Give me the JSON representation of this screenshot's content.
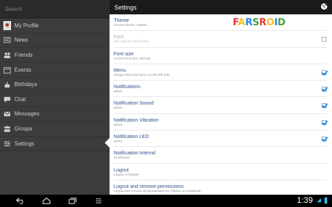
{
  "drawer": {
    "search_placeholder": "Search",
    "items": [
      {
        "label": "My Profile",
        "icon": "avatar"
      },
      {
        "label": "News",
        "icon": "news-icon"
      },
      {
        "label": "Friends",
        "icon": "friends-icon"
      },
      {
        "label": "Events",
        "icon": "calendar-icon"
      },
      {
        "label": "Birthdays",
        "icon": "birthday-icon"
      },
      {
        "label": "Chat",
        "icon": "chat-icon"
      },
      {
        "label": "Messages",
        "icon": "mail-icon"
      },
      {
        "label": "Groups",
        "icon": "groups-icon"
      },
      {
        "label": "Settings",
        "icon": "settings-icon"
      }
    ]
  },
  "header": {
    "title": "Settings"
  },
  "logo": {
    "text": "FARSROID",
    "colors": [
      "#e53935",
      "#fbc02d",
      "#1e88e5",
      "#43a047"
    ]
  },
  "settings": [
    {
      "title": "Theme",
      "subtitle": "Current theme: Classic",
      "checkbox": null,
      "enabled": true
    },
    {
      "title": "Font",
      "subtitle": "Use default Android font",
      "checkbox": false,
      "enabled": false
    },
    {
      "title": "Font size",
      "subtitle": "Current font size: Normal",
      "checkbox": null,
      "enabled": true
    },
    {
      "title": "Menu",
      "subtitle": "Always show the menu on the left side.",
      "checkbox": true,
      "enabled": true
    },
    {
      "title": "Notifications",
      "subtitle": "active",
      "checkbox": true,
      "enabled": true
    },
    {
      "title": "Notification Sound",
      "subtitle": "active",
      "checkbox": true,
      "enabled": true
    },
    {
      "title": "Notification Vibration",
      "subtitle": "active",
      "checkbox": true,
      "enabled": true
    },
    {
      "title": "Notification LED",
      "subtitle": "active",
      "checkbox": true,
      "enabled": true
    },
    {
      "title": "Notification Interval",
      "subtitle": "15 Minutes",
      "checkbox": null,
      "enabled": true
    },
    {
      "title": "Logout",
      "subtitle": "Logout of Flipster",
      "checkbox": null,
      "enabled": true
    },
    {
      "title": "Logout and remove permissions",
      "subtitle": "Logout and remove all permissions for Flipster on Facebook",
      "checkbox": null,
      "enabled": true
    }
  ],
  "system_bar": {
    "time": "1:39"
  }
}
